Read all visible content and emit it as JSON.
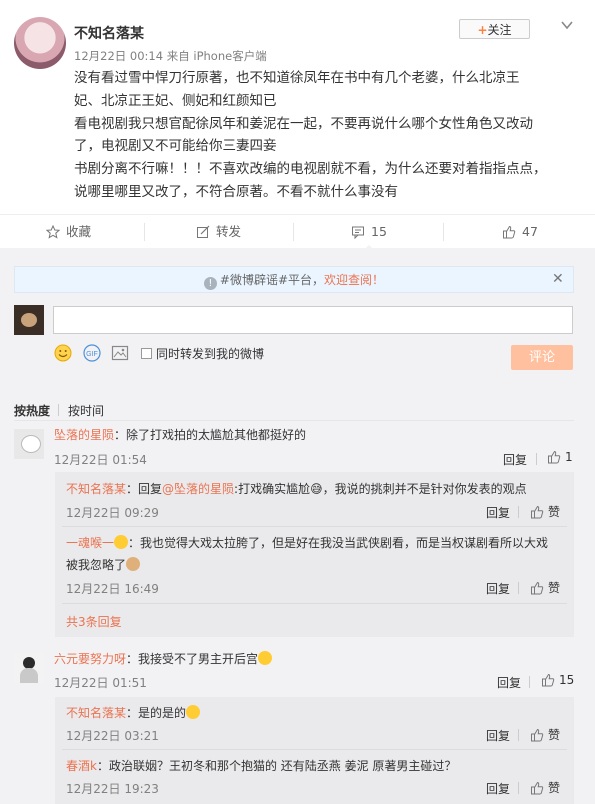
{
  "post": {
    "author": "不知名落某",
    "meta": "12月22日 00:14 来自 iPhone客户端",
    "follow_label": "关注",
    "lines": [
      "没有看过雪中悍刀行原著，也不知道徐凤年在书中有几个老婆，什么北凉王",
      "妃、北凉正王妃、侧妃和红颜知已",
      "看电视剧我只想官配徐凤年和姜泥在一起，不要再说什么哪个女性角色又改动",
      "了，电视剧又不可能给你三妻四妾",
      "书剧分离不行嘛！！！不喜欢改编的电视剧就不看，为什么还要对着指指点点，",
      "说哪里哪里又改了，不符合原著。不看不就什么事没有"
    ]
  },
  "actions": {
    "favorite": "收藏",
    "repost": "转发",
    "comment": "15",
    "like": "47"
  },
  "notice": {
    "prefix": "#微博辟谣#平台，",
    "highlight": "欢迎查阅！"
  },
  "composer": {
    "repost_label": "同时转发到我的微博",
    "submit": "评论"
  },
  "sort": {
    "by_hot": "按热度",
    "by_time": "按时间"
  },
  "comments": [
    {
      "user": "坠落的星陨",
      "text": "：除了打戏拍的太尴尬其他都挺好的",
      "time": "12月22日 01:54",
      "reply": "回复",
      "likes": "1",
      "replies": [
        {
          "user": "不知名落某",
          "text_a": "：回复",
          "mention": "@坠落的星陨",
          "text_b": ":打戏确实尴尬😅，我说的挑刺并不是针对你发表的观点",
          "time": "12月22日 09:29",
          "reply": "回复",
          "like": "赞"
        },
        {
          "user": "一魂喉一",
          "text_a": "：我也觉得大戏太拉胯了，但是好在我没当武侠剧看，而是当权谋剧看所以大戏",
          "text_c": "被我忽略了",
          "time": "12月22日 16:49",
          "reply": "回复",
          "like": "赞"
        }
      ],
      "more": "共3条回复"
    },
    {
      "user": "六元要努力呀",
      "text": "：我接受不了男主开后宫",
      "time": "12月22日 01:51",
      "reply": "回复",
      "likes": "15",
      "replies": [
        {
          "user": "不知名落某",
          "text_a": "：是的是的",
          "time": "12月22日 03:21",
          "reply": "回复",
          "like": "赞"
        },
        {
          "user": "春酒k",
          "text_a": "：政治联姻？王初冬和那个抱猫的 还有陆丞燕 姜泥 原著男主碰过？",
          "time": "12月22日 19:23",
          "reply": "回复",
          "like": "赞"
        }
      ]
    }
  ]
}
